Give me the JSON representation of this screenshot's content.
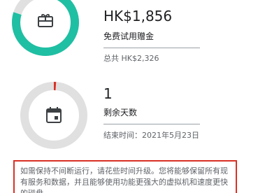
{
  "credit": {
    "amount": "HK$1,856",
    "label": "免费试用赠金",
    "total": "总共 HK$2,326",
    "ring_fraction_remaining": 0.798,
    "ring_color": "#1fbfa3",
    "icon": "gift-card-icon"
  },
  "days": {
    "number": "1",
    "label": "剩余天数",
    "end_date": "结束时间：2021年5月23日",
    "ring_fraction_remaining": 0.011,
    "ring_color": "#d93025",
    "icon": "calendar-icon"
  },
  "notice": {
    "text": "如需保持不间断运行，请花些时间升级。您将能够保留所有现有服务和数据，并且能够使用功能更强大的虚拟机和速度更快的磁盘。",
    "border_color": "#d93025"
  },
  "colors": {
    "ring_track": "#e0e0e0",
    "icon": "#3c4043"
  }
}
